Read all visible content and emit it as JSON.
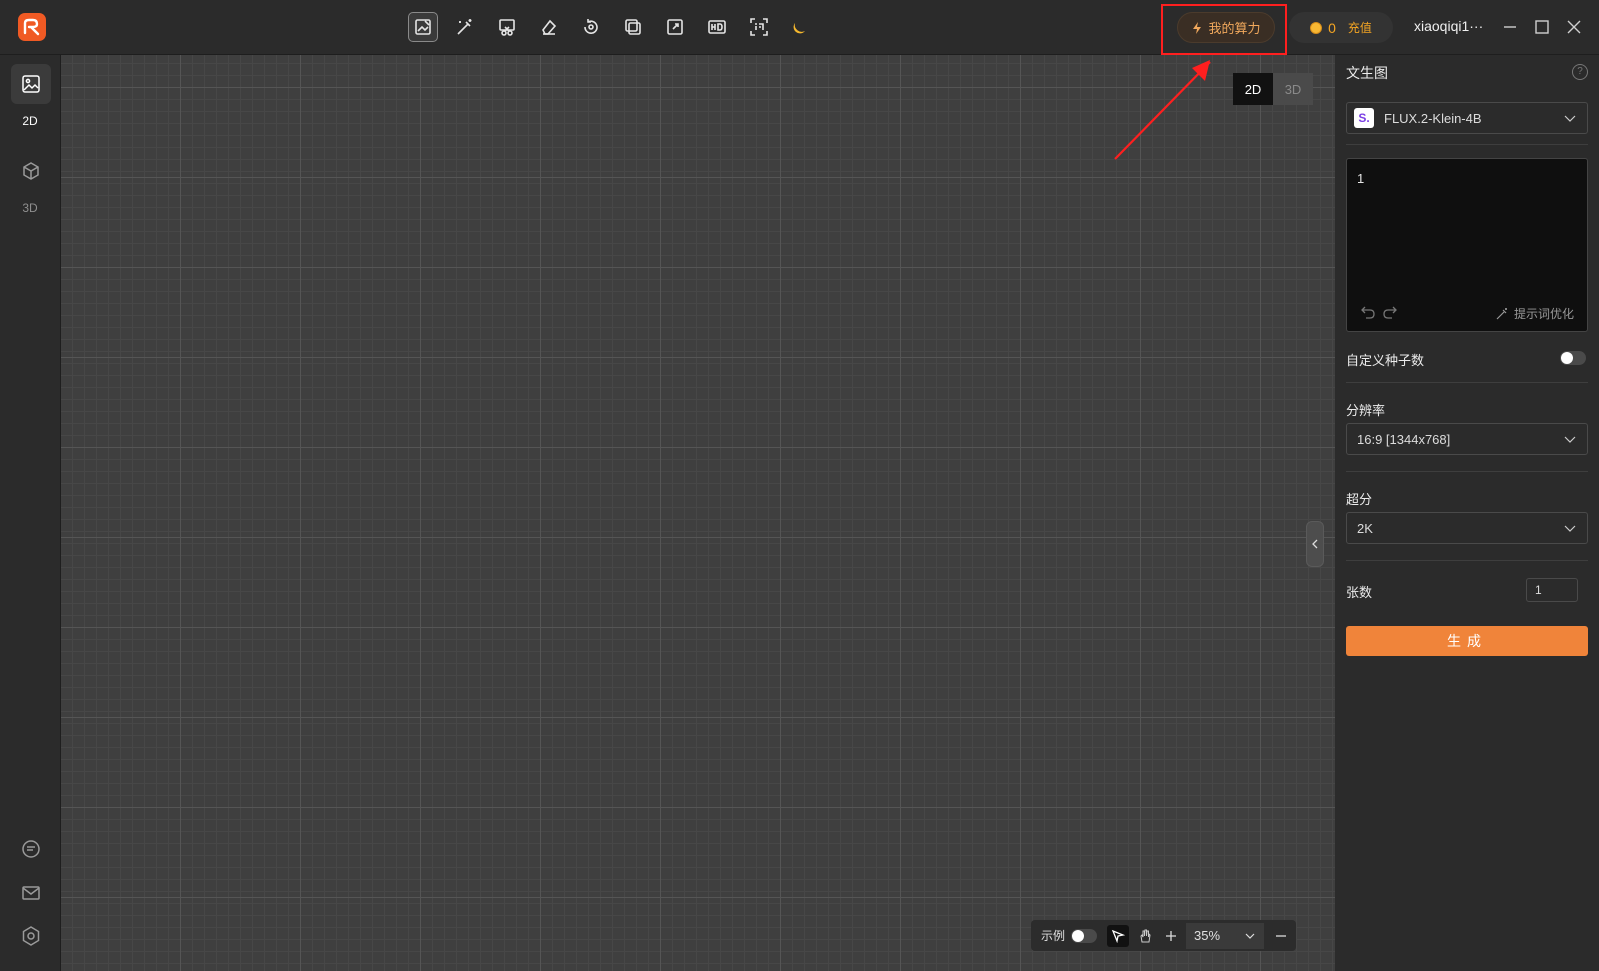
{
  "toolbar": {
    "icons": [
      "image-edit-icon",
      "magic-wand-icon",
      "cut-image-icon",
      "eraser-icon",
      "rotate-icon",
      "layers-icon",
      "expand-icon",
      "hd-icon",
      "ocr-word-icon",
      "moon-icon"
    ]
  },
  "header": {
    "power_label": "我的算力",
    "coin_count": "0",
    "recharge_label": "充值",
    "username": "xiaoqiqi1···"
  },
  "left_rail": {
    "items": [
      {
        "label": "2D",
        "icon": "image-icon",
        "active": true
      },
      {
        "label": "3D",
        "icon": "cube-icon",
        "active": false
      }
    ],
    "bottom_icons": [
      "chat-icon",
      "mail-icon",
      "settings-icon"
    ]
  },
  "canvas": {
    "dim_options": [
      "2D",
      "3D"
    ],
    "selected_dim": "2D",
    "bottom_toolbar": {
      "example_label": "示例",
      "zoom": "35%"
    }
  },
  "right_panel": {
    "title": "文生图",
    "model": {
      "name": "FLUX.2-Klein-4B",
      "badge": "S."
    },
    "prompt_text": "1",
    "prompt_optimize_label": "提示词优化",
    "custom_seed_label": "自定义种子数",
    "resolution_label": "分辨率",
    "resolution_value": "16:9 [1344x768]",
    "upscale_label": "超分",
    "upscale_value": "2K",
    "count_label": "张数",
    "count_value": "1",
    "generate_label": "生成"
  },
  "colors": {
    "accent": "#f0843a",
    "highlight": "#ff1f1f",
    "brand": "#f05a24"
  }
}
